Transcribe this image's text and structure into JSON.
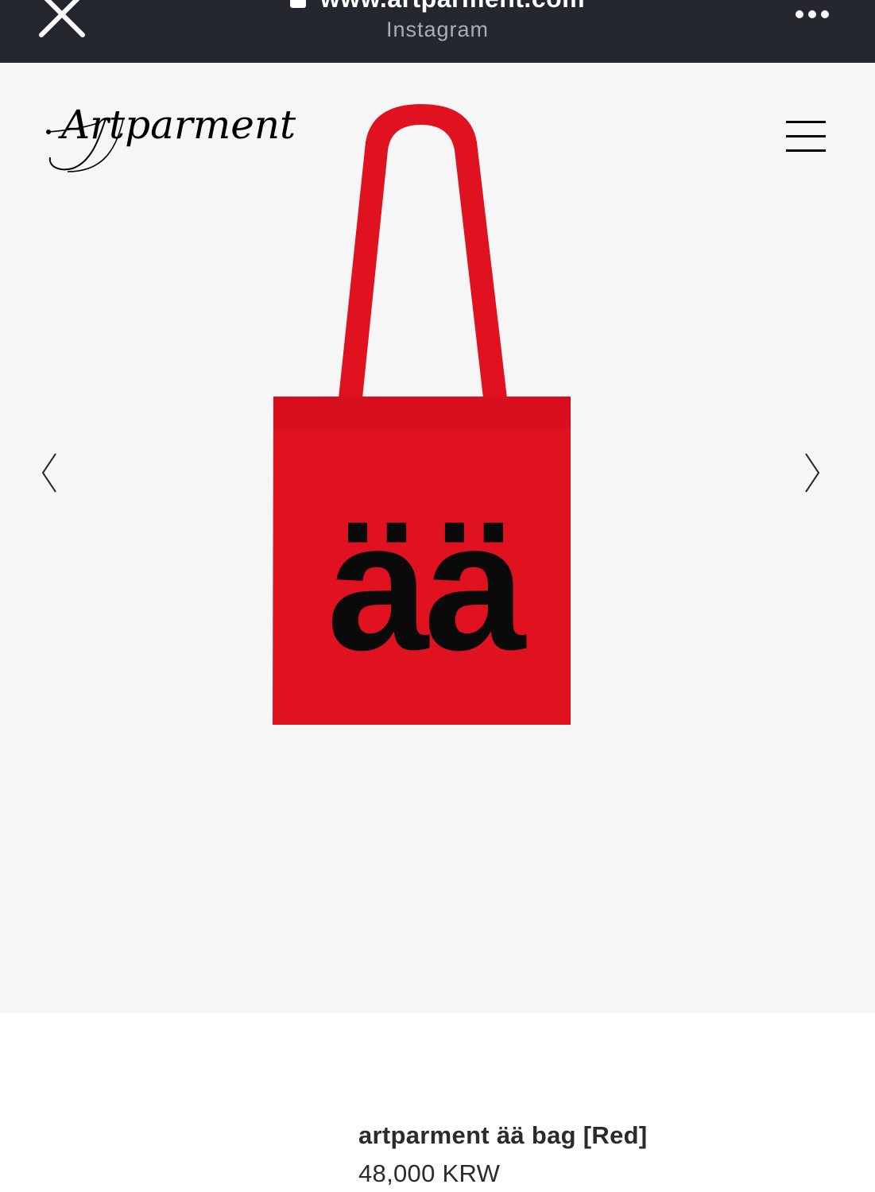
{
  "browser": {
    "url": "www.artparment.com",
    "source": "Instagram",
    "close_icon": "close-icon",
    "more_icon": "more-horizontal-icon",
    "lock_icon": "lock-icon"
  },
  "header": {
    "logo_text": "Artparment",
    "menu_icon": "hamburger-menu-icon"
  },
  "gallery": {
    "prev_icon": "chevron-left-icon",
    "next_icon": "chevron-right-icon",
    "bag_print": "ää",
    "bag_color": "#e0121f"
  },
  "product": {
    "name": "artparment ää bag [Red]",
    "price": "48,000 KRW"
  },
  "colors": {
    "topbar_bg": "#25272e",
    "gallery_bg": "#f6f6f6",
    "text": "#2b2b2b"
  }
}
